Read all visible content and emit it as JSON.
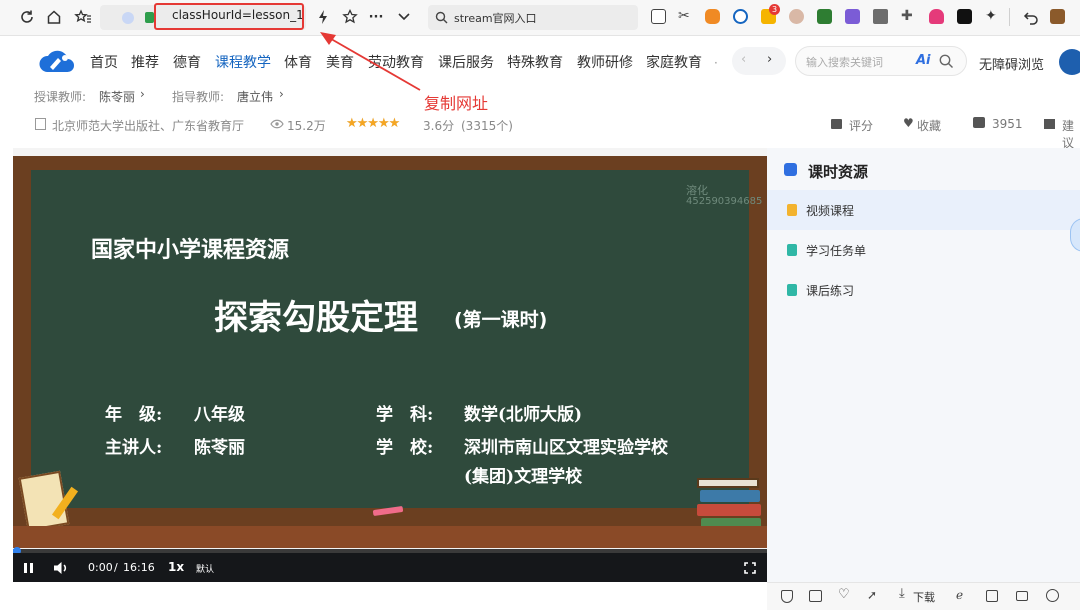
{
  "browser": {
    "address_text": "classHourId=lesson_1",
    "search_placeholder": "stream官网入口",
    "bell_badge": "3",
    "annotation": "复制网址"
  },
  "nav": {
    "items": [
      "首页",
      "推荐",
      "德育",
      "课程教学",
      "体育",
      "美育",
      "劳动教育",
      "课后服务",
      "特殊教育",
      "教师研修",
      "家庭教育"
    ],
    "active": "课程教学",
    "search_placeholder": "输入搜索关键词",
    "ai_label": "Ai",
    "accessible_label": "无障碍浏览"
  },
  "course": {
    "teacher_label": "授课教师:",
    "teacher_name": "陈苓丽",
    "guide_label": "指导教师:",
    "guide_name": "唐立伟",
    "publisher": "北京师范大学出版社、广东省教育厅",
    "views": "15.2万",
    "rating_value": 3.6,
    "rating": "3.6分",
    "rating_count": "(3315个)",
    "actions": {
      "rate": "评分",
      "favorite": "收藏",
      "likes": "3951",
      "suggest": "建议"
    }
  },
  "slide": {
    "watermark_line1": "溶化",
    "watermark_line2": "452590394685",
    "header": "国家中小学课程资源",
    "title": "探索勾股定理",
    "subtitle": "(第一课时)",
    "grade_label": "年　级:",
    "grade": "八年级",
    "subject_label": "学　科:",
    "subject": "数学(北师大版)",
    "speaker_label": "主讲人:",
    "speaker": "陈苓丽",
    "school_label": "学　校:",
    "school_line1": "深圳市南山区文理实验学校",
    "school_line2": "(集团)文理学校"
  },
  "player": {
    "current_time": "0:00",
    "separator": "/",
    "duration": "16:16",
    "speed": "1x",
    "quality": "默认",
    "progress": 0.005
  },
  "sidebar": {
    "title": "课时资源",
    "items": [
      "视频课程",
      "学习任务单",
      "课后练习"
    ]
  },
  "bottom": {
    "download": "下载"
  },
  "colors": {
    "accent": "#1565c0",
    "annotation_red": "#e53935",
    "chalkboard": "#2f4a3c",
    "board_frame": "#6b3f20"
  }
}
